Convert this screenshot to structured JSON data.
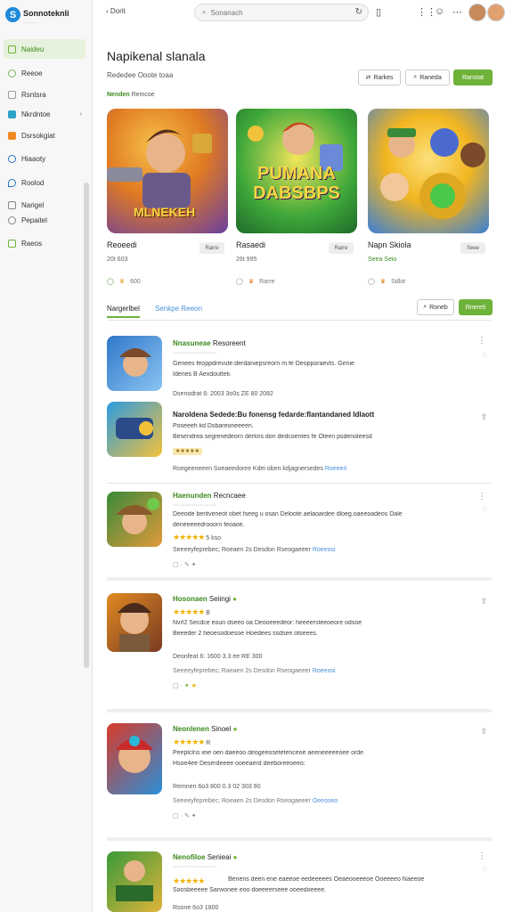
{
  "app": {
    "name": "Sonnoteknli",
    "tagline": "············"
  },
  "sidebar": {
    "items": [
      {
        "label": "Naideu",
        "color": "#6fb23a"
      },
      {
        "label": "Reeoe",
        "color": "#7bb661"
      },
      {
        "label": "Rsntsra",
        "color": "#9a9a9a"
      },
      {
        "label": "Nkrdntoe",
        "color": "#2aa3c7"
      },
      {
        "label": "Dsrsokgiat",
        "color": "#f08a24"
      },
      {
        "label": "Hiaaoty",
        "color": "#2d74c8"
      },
      {
        "label": "Roolod",
        "color": "#2d74c8"
      },
      {
        "label": "Narigel",
        "color": "#888888"
      },
      {
        "label": "Pepaitel",
        "color": "#888888"
      },
      {
        "label": "Raeos",
        "color": "#6fb23a"
      }
    ]
  },
  "topbar": {
    "back_label": "Dorit",
    "search_placeholder": "Sonanach"
  },
  "header": {
    "title": "Napikenal slanala",
    "subtitle": "Rededee Ooote toaa",
    "btn1": "Rarkes",
    "btn2": "Raneda",
    "btn3": "Ranstat"
  },
  "section": {
    "label_bold": "Nenden",
    "label_rest": "Remcoe"
  },
  "featured": [
    {
      "title": "Reoeedi",
      "meta": "20t 603",
      "btn": "Rarre",
      "icon_text": "600",
      "art": "MLNEKEH",
      "bg1": "#e07a22",
      "bg2": "#6a3fa0"
    },
    {
      "title": "Rasaedi",
      "meta": "26t 995",
      "btn": "Rarre",
      "icon_text": "Rarre",
      "art": "PUMANA DABSBPS",
      "bg1": "#3fa83a",
      "bg2": "#f2c13a"
    },
    {
      "title": "Napn Skiola",
      "meta": "Seea Seio",
      "btn": "Seee",
      "icon_text": "Sdlot",
      "art": "",
      "bg1": "#f2b520",
      "bg2": "#3a7fd6"
    }
  ],
  "tabs": {
    "active": "Nargerlbel",
    "other": "Senkpe Reeon",
    "btn": "Roneb",
    "btn_green": "Rnereti"
  },
  "list": [
    {
      "title_bold": "Nnasuneae",
      "title_rest": "Resoreent",
      "line1": "Genees feoppdrevute:derdaniepsreorn m fe Deopporaevts. Genie",
      "line2": "Idenes B Aexdoutteli.",
      "meta": "Dsenodrat 6: 2003 3o0s ZE 80 2082",
      "link": "",
      "bg1": "#2f78c9",
      "bg2": "#8bc4f2"
    },
    {
      "title_bold": "Naroldena Sedede:Bu fonensg fedarde:flantandaned Idlaott",
      "title_rest": "",
      "line1": "Poseeeh kd Dsbareoneeeen.",
      "line2": "Besendrea segrenedeorn derkns don dedcoentes fe Oleen psdenoleesd",
      "meta": "Roegeeneeen Soeaeedoree Kdei oben kdjagnersedes",
      "link": "Roeeeri",
      "bg1": "#2d9be0",
      "bg2": "#f2c13a"
    },
    {
      "title_bold": "Haenunden",
      "title_rest": "Recncaee",
      "line1": "Deeode bentveneot obet fseeg u osan Deloote.aelaoardee dloeg.oaeeoadeos Dale",
      "line2": "deneeeeedrooorn feoaoe.",
      "meta": "Seeeeyfeprebec; Roeaen 2s Desdon Rseogaeeer",
      "link": "Roeeosi",
      "rating": "5 kso",
      "bg1": "#3a8a3a",
      "bg2": "#e09a3a"
    },
    {
      "title_bold": "Hosonaen",
      "title_rest": "Seiingi",
      "line1": "Nvrl2  Secdce eoun dseeo oa Deooeeedeor: heeeersteeoeore odsoe",
      "line2": "Beeeder 2 heoesodoesoe Hoedees ssdsee.otseees.",
      "meta": "Deonfeat 6: 1600 3.3 ee RE 300",
      "link": "",
      "rating": "B",
      "bg1": "#e08a22",
      "bg2": "#7a3a22"
    },
    {
      "title_bold": "Neonlenen",
      "title_rest": "Sinoel",
      "line1": "Peeplclns ieie oen daeeoo deogeeosetetenceoe aeeneeeeeoee orde",
      "line2": "Hsoe4ee  Deserdeeee ooeeaerd deeboreeoeeo:",
      "meta": "Remnen 6o3 800 0.3 02 303 90",
      "link": "Oeeoseo",
      "rating": "R",
      "bg1": "#d83a2a",
      "bg2": "#2a8fd8"
    },
    {
      "title_bold": "Nenofiloe",
      "title_rest": "Senieai",
      "line1": "Benens deen ene eaeeoe eedeeeees Oeaeooeeeoe Ooeeeeo Naeeoe",
      "line2": "Soosbeeeee Sarwonee eoo doeeeerseee ooeedoeeee.",
      "meta": "Rsone 6o3 1800",
      "link": "",
      "rating": "R",
      "bg1": "#3a9a3a",
      "bg2": "#e0b43a"
    }
  ]
}
